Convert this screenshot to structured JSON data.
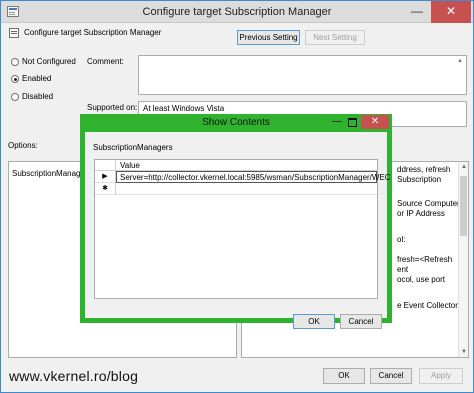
{
  "window": {
    "title": "Configure target Subscription Manager",
    "minimize_glyph": "—",
    "close_glyph": "✕"
  },
  "header": {
    "policy_name": "Configure target Subscription Manager",
    "prev_label": "Previous Setting",
    "next_label": "Next Setting"
  },
  "state": {
    "not_configured_label": "Not Configured",
    "enabled_label": "Enabled",
    "disabled_label": "Disabled",
    "selected": "Enabled"
  },
  "fields": {
    "comment_label": "Comment:",
    "supported_label": "Supported on:",
    "supported_value": "At least Windows Vista"
  },
  "options": {
    "label": "Options:",
    "subscription_label": "SubscriptionManager"
  },
  "help": {
    "lines": [
      "ddress, refresh",
      "Subscription",
      "Source Computer",
      "or IP Address",
      "ol:",
      "fresh=<Refresh",
      "ent",
      "ocol, use port",
      "e Event Collector"
    ]
  },
  "footer": {
    "ok_label": "OK",
    "cancel_label": "Cancel",
    "apply_label": "Apply"
  },
  "watermark": "www.vkernel.ro/blog",
  "dialog": {
    "title": "Show Contents",
    "minimize_glyph": "—",
    "close_glyph": "✕",
    "heading": "SubscriptionManagers",
    "column_header": "Value",
    "rows": [
      {
        "marker": "▶",
        "value": "Server=http://collector.vkernel.local:5985/wsman/SubscriptionManager/WEC"
      },
      {
        "marker": "✱",
        "value": ""
      }
    ],
    "ok_label": "OK",
    "cancel_label": "Cancel"
  },
  "colors": {
    "dialog_border": "#2fb32f",
    "close_button": "#c75050",
    "window_bg": "#f0f0f0"
  }
}
